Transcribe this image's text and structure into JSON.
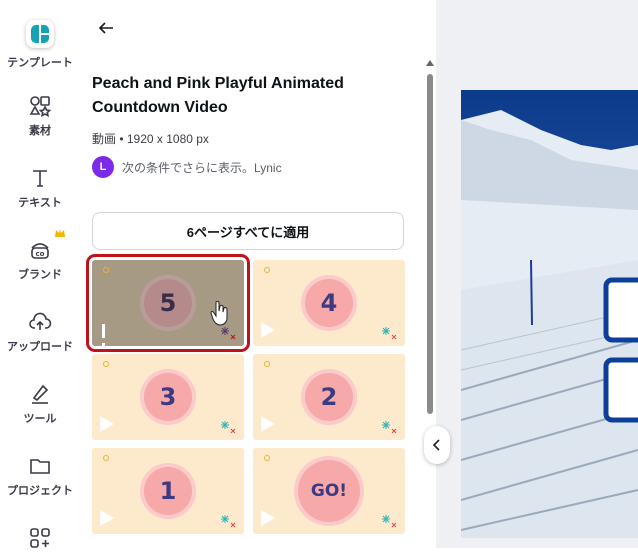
{
  "rail": {
    "items": [
      {
        "label": "テンプレート",
        "icon": "templates-icon",
        "active": true
      },
      {
        "label": "素材",
        "icon": "elements-icon"
      },
      {
        "label": "テキスト",
        "icon": "text-icon"
      },
      {
        "label": "ブランド",
        "icon": "brand-icon"
      },
      {
        "label": "アップロード",
        "icon": "upload-icon"
      },
      {
        "label": "ツール",
        "icon": "tools-icon"
      },
      {
        "label": "プロジェクト",
        "icon": "folder-icon"
      },
      {
        "label": "",
        "icon": "apps-icon"
      }
    ]
  },
  "panel": {
    "title": "Peach and Pink Playful Animated Countdown Video",
    "meta": "動画 • 1920 x 1080 px",
    "author_initial": "L",
    "author_text": "次の条件でさらに表示。Lynic",
    "apply_button": "6ページすべてに適用",
    "pages": [
      {
        "number": "5",
        "selected": true,
        "state": "playing"
      },
      {
        "number": "4",
        "state": "paused"
      },
      {
        "number": "3",
        "state": "paused"
      },
      {
        "number": "2",
        "state": "paused"
      },
      {
        "number": "1",
        "state": "paused"
      },
      {
        "number": "GO!",
        "state": "paused"
      }
    ]
  },
  "colors": {
    "accent": "#7d2ae8",
    "selection": "#c0121b",
    "page_bg": "#fde9cc",
    "number_color": "#3b3a82"
  }
}
